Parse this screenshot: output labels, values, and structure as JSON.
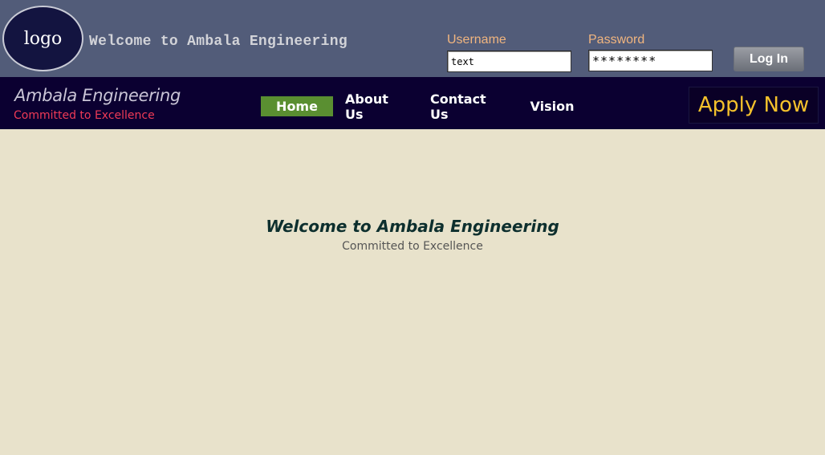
{
  "header": {
    "logo_text": "logo",
    "welcome_text": "Welcome to Ambala Engineering",
    "username_label": "Username",
    "username_value": "text",
    "password_label": "Password",
    "password_value": "********",
    "login_label": "Log In"
  },
  "nav": {
    "brand_name": "Ambala Engineering",
    "brand_tagline": "Committed to Excellence",
    "items": [
      {
        "label": "Home",
        "active": true
      },
      {
        "label": "About Us",
        "active": false
      },
      {
        "label": "Contact Us",
        "active": false
      },
      {
        "label": "Vision",
        "active": false
      }
    ],
    "apply_label": "Apply Now"
  },
  "main": {
    "title": "Welcome to Ambala Engineering",
    "subtitle": "Committed to Excellence"
  },
  "colors": {
    "topbar": "#525c79",
    "navbar": "#0b0031",
    "page_background": "#e8e2cb",
    "active_nav": "#5a8f31",
    "apply_text": "#f4c12c",
    "tagline": "#ee3a56"
  }
}
